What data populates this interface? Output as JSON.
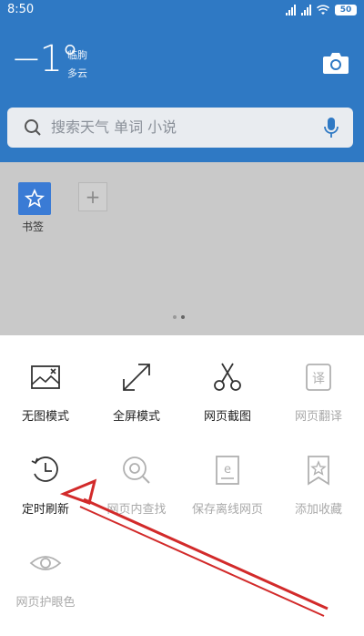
{
  "status": {
    "time": "8:50",
    "battery": "50"
  },
  "weather": {
    "temp": "−1°",
    "city": "临朐",
    "condition": "多云"
  },
  "search": {
    "placeholder": "搜索天气 单词 小说"
  },
  "bookmarks": {
    "label": "书签"
  },
  "menu": [
    {
      "label": "无图模式",
      "icon": "no-image-icon",
      "dim": false
    },
    {
      "label": "全屏模式",
      "icon": "fullscreen-icon",
      "dim": false
    },
    {
      "label": "网页截图",
      "icon": "scissors-icon",
      "dim": false
    },
    {
      "label": "网页翻译",
      "icon": "translate-icon",
      "dim": true
    },
    {
      "label": "定时刷新",
      "icon": "timer-refresh-icon",
      "dim": false
    },
    {
      "label": "网页内查找",
      "icon": "find-in-page-icon",
      "dim": true
    },
    {
      "label": "保存离线网页",
      "icon": "save-offline-icon",
      "dim": true
    },
    {
      "label": "添加收藏",
      "icon": "add-favorite-icon",
      "dim": true
    },
    {
      "label": "网页护眼色",
      "icon": "eye-icon",
      "dim": true
    }
  ],
  "colors": {
    "accent": "#2f79c4",
    "bookmark": "#3a7bd5",
    "arrow": "#d22a2a"
  }
}
